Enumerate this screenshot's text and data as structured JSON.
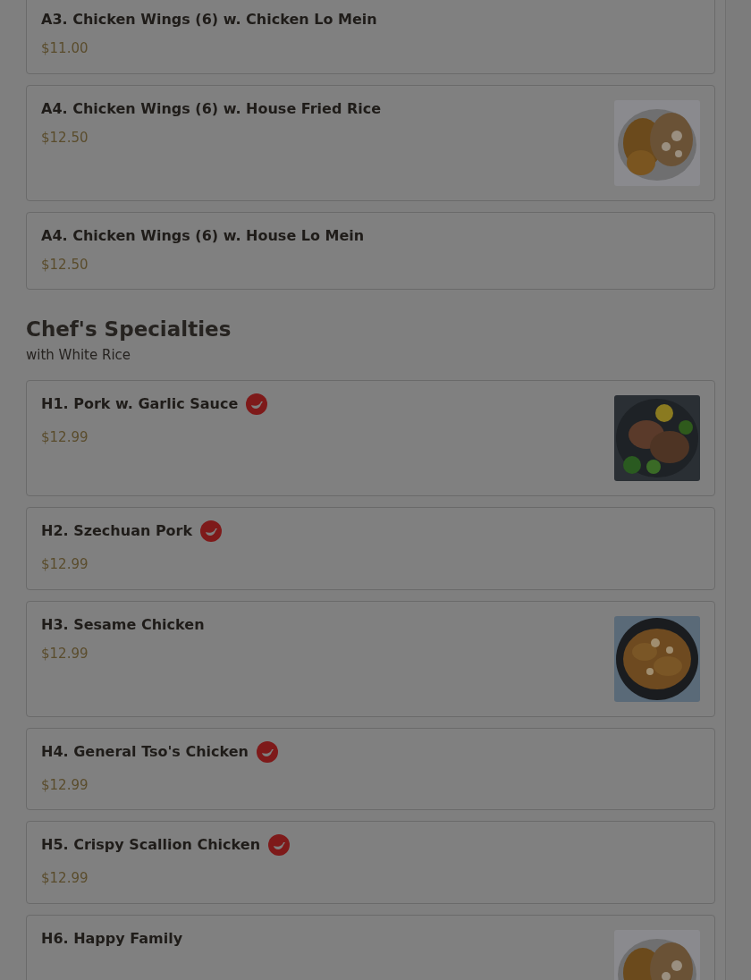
{
  "sections": [
    {
      "items": [
        {
          "name": "A3. Chicken Wings (6) w. Chicken Lo Mein",
          "price": "$11.00",
          "spicy": false,
          "picture": false
        },
        {
          "name": "A4. Chicken Wings (6) w. House Fried Rice",
          "price": "$12.50",
          "spicy": false,
          "picture": true
        },
        {
          "name": "A4. Chicken Wings (6) w. House Lo Mein",
          "price": "$12.50",
          "spicy": false,
          "picture": false
        }
      ]
    },
    {
      "title": "Chef's Specialties",
      "subtitle": "with White Rice",
      "items": [
        {
          "name": "H1. Pork w. Garlic Sauce",
          "price": "$12.99",
          "spicy": true,
          "picture": true
        },
        {
          "name": "H2. Szechuan Pork",
          "price": "$12.99",
          "spicy": true,
          "picture": false
        },
        {
          "name": "H3. Sesame Chicken",
          "price": "$12.99",
          "spicy": false,
          "picture": true
        },
        {
          "name": "H4. General Tso's Chicken",
          "price": "$12.99",
          "spicy": true,
          "picture": false
        },
        {
          "name": "H5. Crispy Scallion Chicken",
          "price": "$12.99",
          "spicy": true,
          "picture": false
        },
        {
          "name": "H6. Happy Family",
          "spicy": false,
          "picture": true
        }
      ]
    }
  ]
}
